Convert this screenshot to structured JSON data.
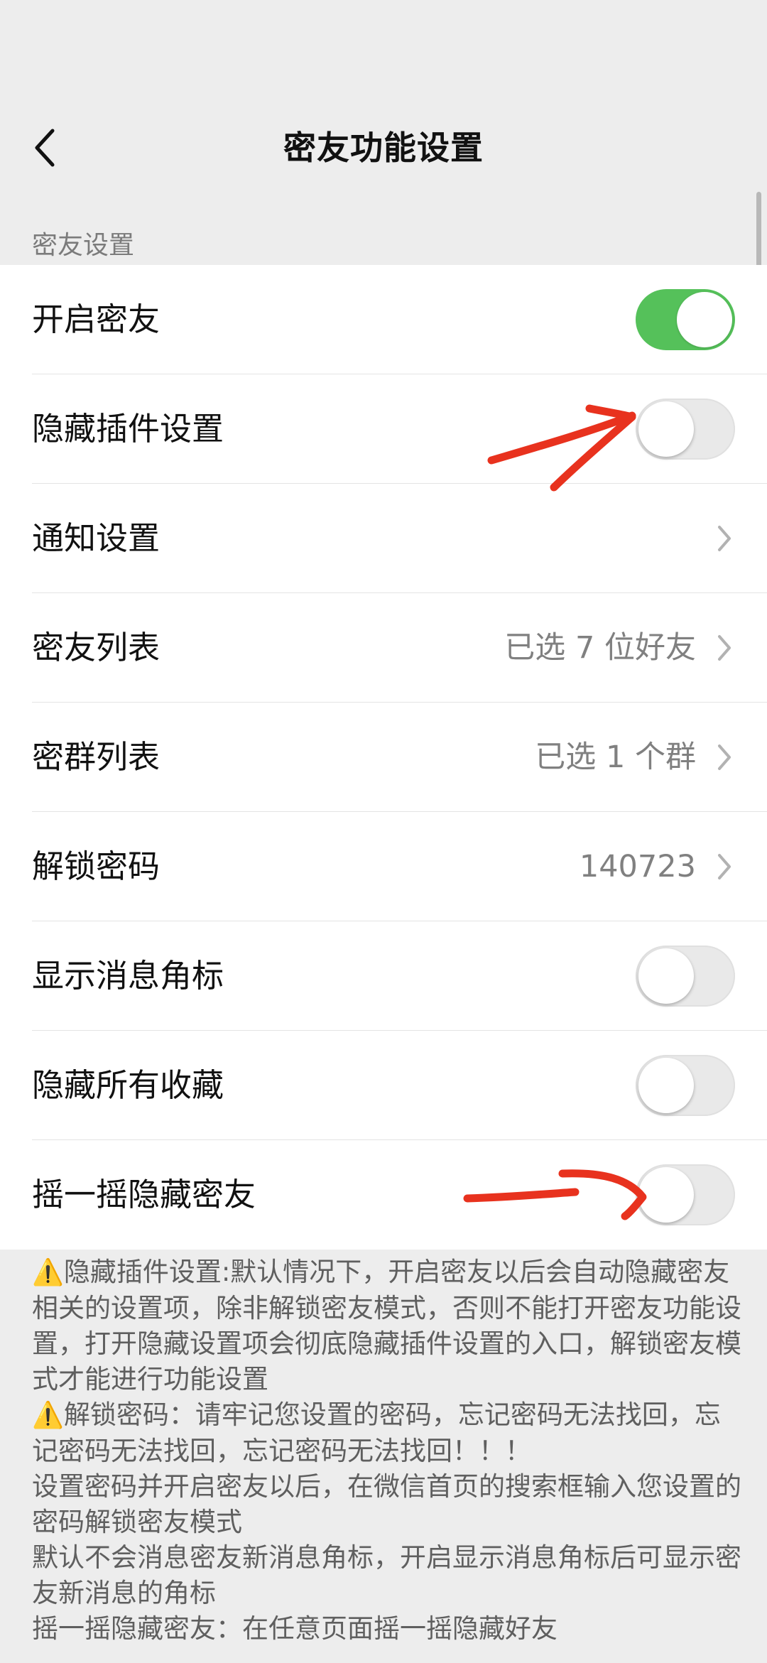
{
  "header": {
    "title": "密友功能设置"
  },
  "section": {
    "label": "密友设置"
  },
  "rows": [
    {
      "label": "开启密友"
    },
    {
      "label": "隐藏插件设置"
    },
    {
      "label": "通知设置"
    },
    {
      "label": "密友列表",
      "value": "已选 7 位好友"
    },
    {
      "label": "密群列表",
      "value": "已选 1 个群"
    },
    {
      "label": "解锁密码",
      "value": "140723"
    },
    {
      "label": "显示消息角标"
    },
    {
      "label": "隐藏所有收藏"
    },
    {
      "label": "摇一摇隐藏密友"
    }
  ],
  "toggles": {
    "enable_mizhou": true,
    "hide_plugin_settings": false,
    "show_badge": false,
    "hide_favorites": false,
    "shake_hide": false
  },
  "notes": {
    "warning_icon": "warning-icon",
    "lines": [
      "隐藏插件设置:默认情况下，开启密友以后会自动隐藏密友相关的设置项，除非解锁密友模式，否则不能打开密友功能设置，打开隐藏设置项会彻底隐藏插件设置的入口，解锁密友模式才能进行功能设置",
      "解锁密码：请牢记您设置的密码，忘记密码无法找回，忘记密码无法找回，忘记密码无法找回！！！",
      "设置密码并开启密友以后，在微信首页的搜索框输入您设置的密码解锁密友模式",
      "默认不会消息密友新消息角标，开启显示消息角标后可显示密友新消息的角标",
      "摇一摇隐藏密友：在任意页面摇一摇隐藏好友"
    ]
  },
  "colors": {
    "toggle_on": "#55c15a",
    "annotation_arrow": "#e8321e",
    "background": "#ededed"
  }
}
